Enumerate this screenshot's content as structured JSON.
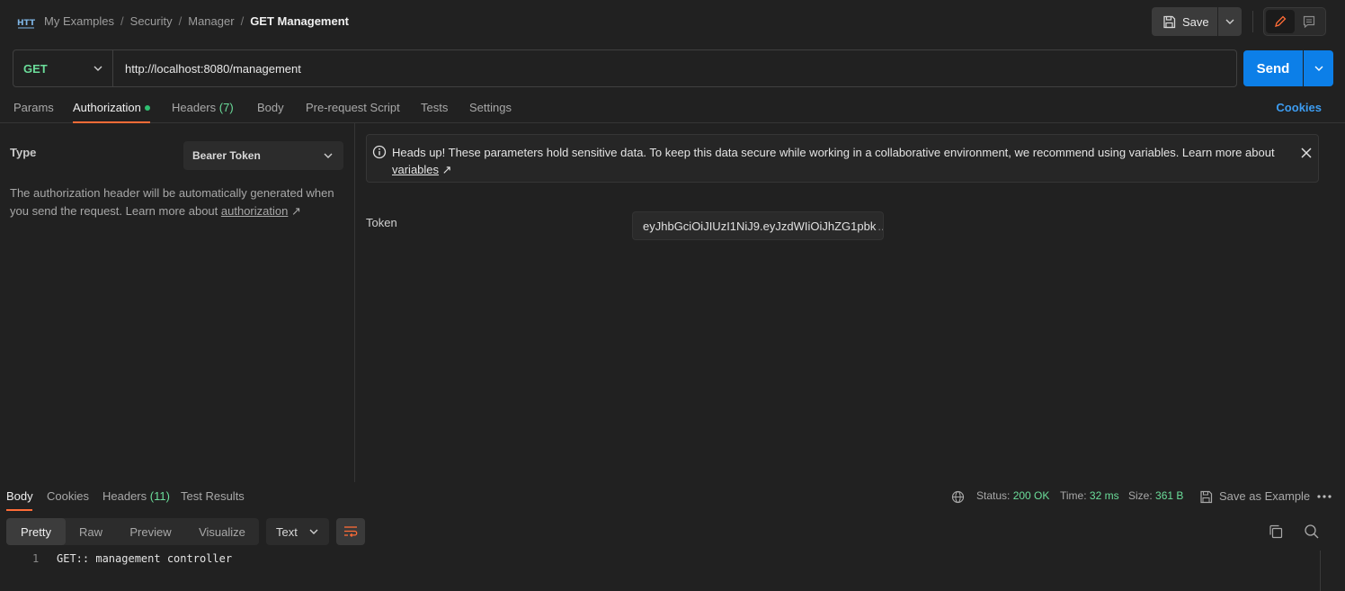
{
  "breadcrumb": {
    "items": [
      "My Examples",
      "Security",
      "Manager"
    ],
    "current": "GET Management"
  },
  "toolbar": {
    "save_label": "Save"
  },
  "request": {
    "method": "GET",
    "url": "http://localhost:8080/management",
    "send_label": "Send"
  },
  "request_tabs": [
    {
      "label": "Params"
    },
    {
      "label": "Authorization"
    },
    {
      "label": "Headers",
      "count": "(7)"
    },
    {
      "label": "Body"
    },
    {
      "label": "Pre-request Script"
    },
    {
      "label": "Tests"
    },
    {
      "label": "Settings"
    }
  ],
  "cookies_label": "Cookies",
  "auth": {
    "type_label": "Type",
    "type_value": "Bearer Token",
    "description": "The authorization header will be automatically generated when you send the request. Learn more about ",
    "description_link": "authorization",
    "arrow": "↗"
  },
  "alert": {
    "text": "Heads up! These parameters hold sensitive data. To keep this data secure while working in a collaborative environment, we recommend using variables. Learn more about ",
    "link": "variables",
    "arrow": "↗"
  },
  "token": {
    "label": "Token",
    "value": "eyJhbGciOiJIUzI1NiJ9.eyJzdWIiOiJhZG1pbk",
    "ellipsis": "..."
  },
  "response_tabs": [
    {
      "label": "Body"
    },
    {
      "label": "Cookies"
    },
    {
      "label": "Headers",
      "count": "(11)"
    },
    {
      "label": "Test Results"
    }
  ],
  "response_meta": {
    "status_label": "Status:",
    "status_value": "200 OK",
    "time_label": "Time:",
    "time_value": "32 ms",
    "size_label": "Size:",
    "size_value": "361 B",
    "save_example_label": "Save as Example"
  },
  "view_modes": [
    "Pretty",
    "Raw",
    "Preview",
    "Visualize"
  ],
  "format_value": "Text",
  "code": {
    "line_number": "1",
    "line_text": "GET:: management controller"
  },
  "colors": {
    "accent_orange": "#ff6c37",
    "send_blue": "#0c7fe8",
    "method_green": "#6bdd9a",
    "link_blue": "#3d9cf0"
  }
}
